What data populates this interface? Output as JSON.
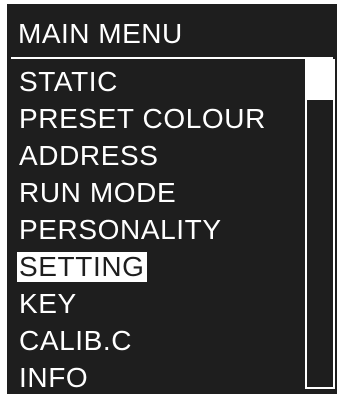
{
  "menu": {
    "title": "MAIN MENU",
    "selected_index": 6,
    "items": [
      {
        "label": "STATIC"
      },
      {
        "label": "PRESET COLOUR"
      },
      {
        "label": "ADDRESS"
      },
      {
        "label": "RUN MODE"
      },
      {
        "label": "PERSONALITY"
      },
      {
        "label": "SETTING"
      },
      {
        "label": "KEY"
      },
      {
        "label": "CALIB.C"
      },
      {
        "label": "INFO"
      }
    ]
  },
  "scrollbar": {
    "position_fraction": 0.0,
    "visible_fraction": 0.12
  },
  "colors": {
    "background": "#1e1e1e",
    "foreground": "#ffffff",
    "highlight_bg": "#ffffff",
    "highlight_fg": "#1e1e1e"
  }
}
